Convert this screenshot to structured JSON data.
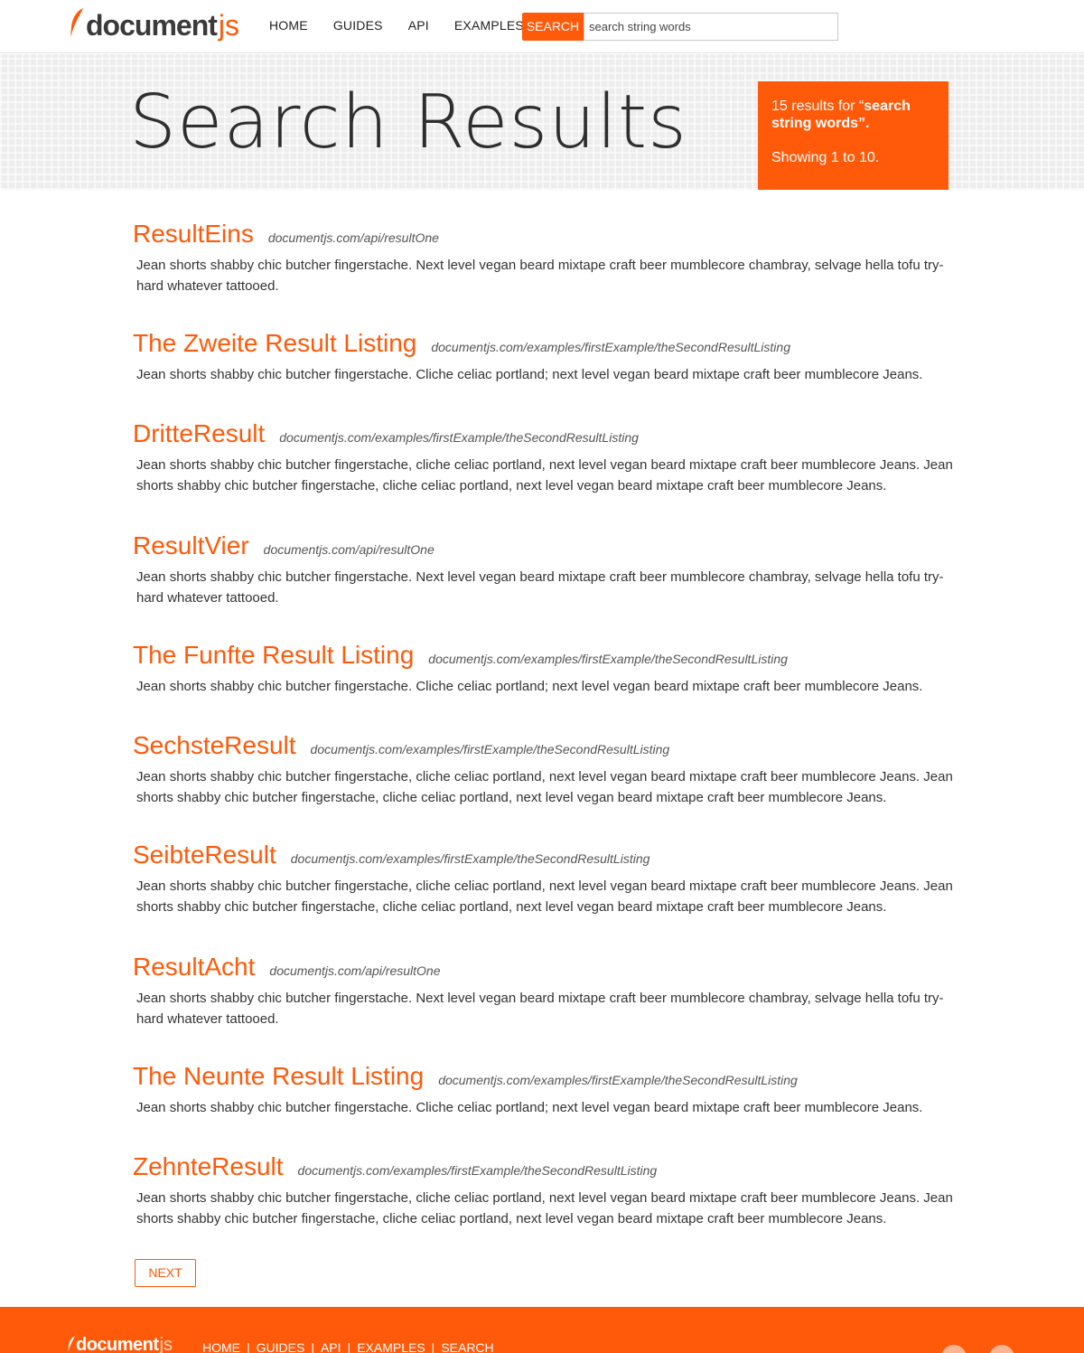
{
  "header": {
    "logo_doc": "document",
    "logo_js": "js",
    "nav": [
      "HOME",
      "GUIDES",
      "API",
      "EXAMPLES"
    ],
    "search_label": "SEARCH",
    "search_value": "search string words"
  },
  "hero": {
    "title": "Search Results",
    "summary_prefix": "15 results for “",
    "summary_query": "search string words",
    "summary_suffix": "”.",
    "showing": "Showing 1 to 10."
  },
  "results": [
    {
      "title": "ResultEins",
      "url": "documentjs.com/api/resultOne",
      "desc": "Jean shorts shabby chic butcher fingerstache. Next level vegan beard mixtape craft beer mumblecore chambray, selvage hella tofu try-hard whatever tattooed."
    },
    {
      "title": "The Zweite Result Listing",
      "url": "documentjs.com/examples/firstExample/theSecondResultListing",
      "desc": "Jean shorts shabby chic butcher fingerstache. Cliche celiac portland; next level vegan beard mixtape craft beer mumblecore Jeans."
    },
    {
      "title": "DritteResult",
      "url": "documentjs.com/examples/firstExample/theSecondResultListing",
      "desc": "Jean shorts shabby chic butcher fingerstache, cliche celiac portland, next level vegan beard mixtape craft beer mumblecore Jeans. Jean shorts shabby chic butcher fingerstache, cliche celiac portland, next level vegan beard mixtape craft beer mumblecore Jeans."
    },
    {
      "title": "ResultVier",
      "url": "documentjs.com/api/resultOne",
      "desc": "Jean shorts shabby chic butcher fingerstache. Next level vegan beard mixtape craft beer mumblecore chambray, selvage hella tofu try-hard whatever tattooed."
    },
    {
      "title": "The Funfte Result Listing",
      "url": "documentjs.com/examples/firstExample/theSecondResultListing",
      "desc": "Jean shorts shabby chic butcher fingerstache. Cliche celiac portland; next level vegan beard mixtape craft beer mumblecore Jeans."
    },
    {
      "title": "SechsteResult",
      "url": "documentjs.com/examples/firstExample/theSecondResultListing",
      "desc": "Jean shorts shabby chic butcher fingerstache, cliche celiac portland, next level vegan beard mixtape craft beer mumblecore Jeans. Jean shorts shabby chic butcher fingerstache, cliche celiac portland, next level vegan beard mixtape craft beer mumblecore Jeans."
    },
    {
      "title": "SeibteResult",
      "url": "documentjs.com/examples/firstExample/theSecondResultListing",
      "desc": "Jean shorts shabby chic butcher fingerstache, cliche celiac portland, next level vegan beard mixtape craft beer mumblecore Jeans. Jean shorts shabby chic butcher fingerstache, cliche celiac portland, next level vegan beard mixtape craft beer mumblecore Jeans."
    },
    {
      "title": "ResultAcht",
      "url": "documentjs.com/api/resultOne",
      "desc": "Jean shorts shabby chic butcher fingerstache. Next level vegan beard mixtape craft beer mumblecore chambray, selvage hella tofu try-hard whatever tattooed."
    },
    {
      "title": "The Neunte Result Listing",
      "url": "documentjs.com/examples/firstExample/theSecondResultListing",
      "desc": "Jean shorts shabby chic butcher fingerstache. Cliche celiac portland; next level vegan beard mixtape craft beer mumblecore Jeans."
    },
    {
      "title": "ZehnteResult",
      "url": "documentjs.com/examples/firstExample/theSecondResultListing",
      "desc": "Jean shorts shabby chic butcher fingerstache, cliche celiac portland, next level vegan beard mixtape craft beer mumblecore Jeans. Jean shorts shabby chic butcher fingerstache, cliche celiac portland, next level vegan beard mixtape craft beer mumblecore Jeans."
    }
  ],
  "pagination": {
    "next_label": "NEXT"
  },
  "footer": {
    "logo_doc": "document",
    "logo_js": "js",
    "nav": [
      "HOME",
      "GUIDES",
      "API",
      "EXAMPLES",
      "SEARCH"
    ]
  },
  "colors": {
    "accent": "#ff5a0a",
    "text": "#333333",
    "hero_bg": "#ededed"
  }
}
